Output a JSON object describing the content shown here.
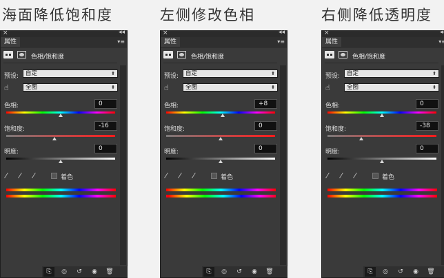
{
  "colors": {
    "panel_bg": "#3a3a3a",
    "field_bg": "#111111",
    "hue_gradient": [
      "#ff0000",
      "#ffff00",
      "#00ff00",
      "#00ffff",
      "#0000ff",
      "#ff00ff",
      "#ff0000"
    ]
  },
  "panels": [
    {
      "title": "海面降低饱和度",
      "tab_label": "属性",
      "adjustment_label": "色相/饱和度",
      "preset_label": "预设:",
      "preset_value": "自定",
      "channel_value": "全图",
      "hue_label": "色相:",
      "hue_value": "0",
      "hue_knob_fraction": 0.5,
      "saturation_label": "饱和度:",
      "saturation_value": "-16",
      "saturation_knob_fraction": 0.44,
      "lightness_label": "明度:",
      "lightness_value": "0",
      "lightness_knob_fraction": 0.5,
      "colorize_label": "着色",
      "bottom_spectrum_shift": 0.0
    },
    {
      "title": "左侧修改色相",
      "tab_label": "属性",
      "adjustment_label": "色相/饱和度",
      "preset_label": "预设:",
      "preset_value": "自定",
      "channel_value": "全图",
      "hue_label": "色相:",
      "hue_value": "+8",
      "hue_knob_fraction": 0.52,
      "saturation_label": "饱和度:",
      "saturation_value": "0",
      "saturation_knob_fraction": 0.5,
      "lightness_label": "明度:",
      "lightness_value": "0",
      "lightness_knob_fraction": 0.5,
      "colorize_label": "着色",
      "bottom_spectrum_shift": 0.02
    },
    {
      "title": "右侧降低透明度",
      "tab_label": "属性",
      "adjustment_label": "色相/饱和度",
      "preset_label": "预设:",
      "preset_value": "自定",
      "channel_value": "全图",
      "hue_label": "色相:",
      "hue_value": "0",
      "hue_knob_fraction": 0.5,
      "saturation_label": "饱和度:",
      "saturation_value": "-38",
      "saturation_knob_fraction": 0.31,
      "lightness_label": "明度:",
      "lightness_value": "0",
      "lightness_knob_fraction": 0.5,
      "colorize_label": "着色",
      "bottom_spectrum_shift": 0.0
    }
  ],
  "icons": {
    "close": "×",
    "collapse": "◂◂",
    "panel_menu": "▾≡",
    "dropdown": "⬍",
    "hand_tool": "☝",
    "eyedropper": "⁄",
    "clip": "⎘",
    "view_previous": "◎",
    "reset": "↺",
    "visibility": "◉",
    "delete": "🗑"
  }
}
